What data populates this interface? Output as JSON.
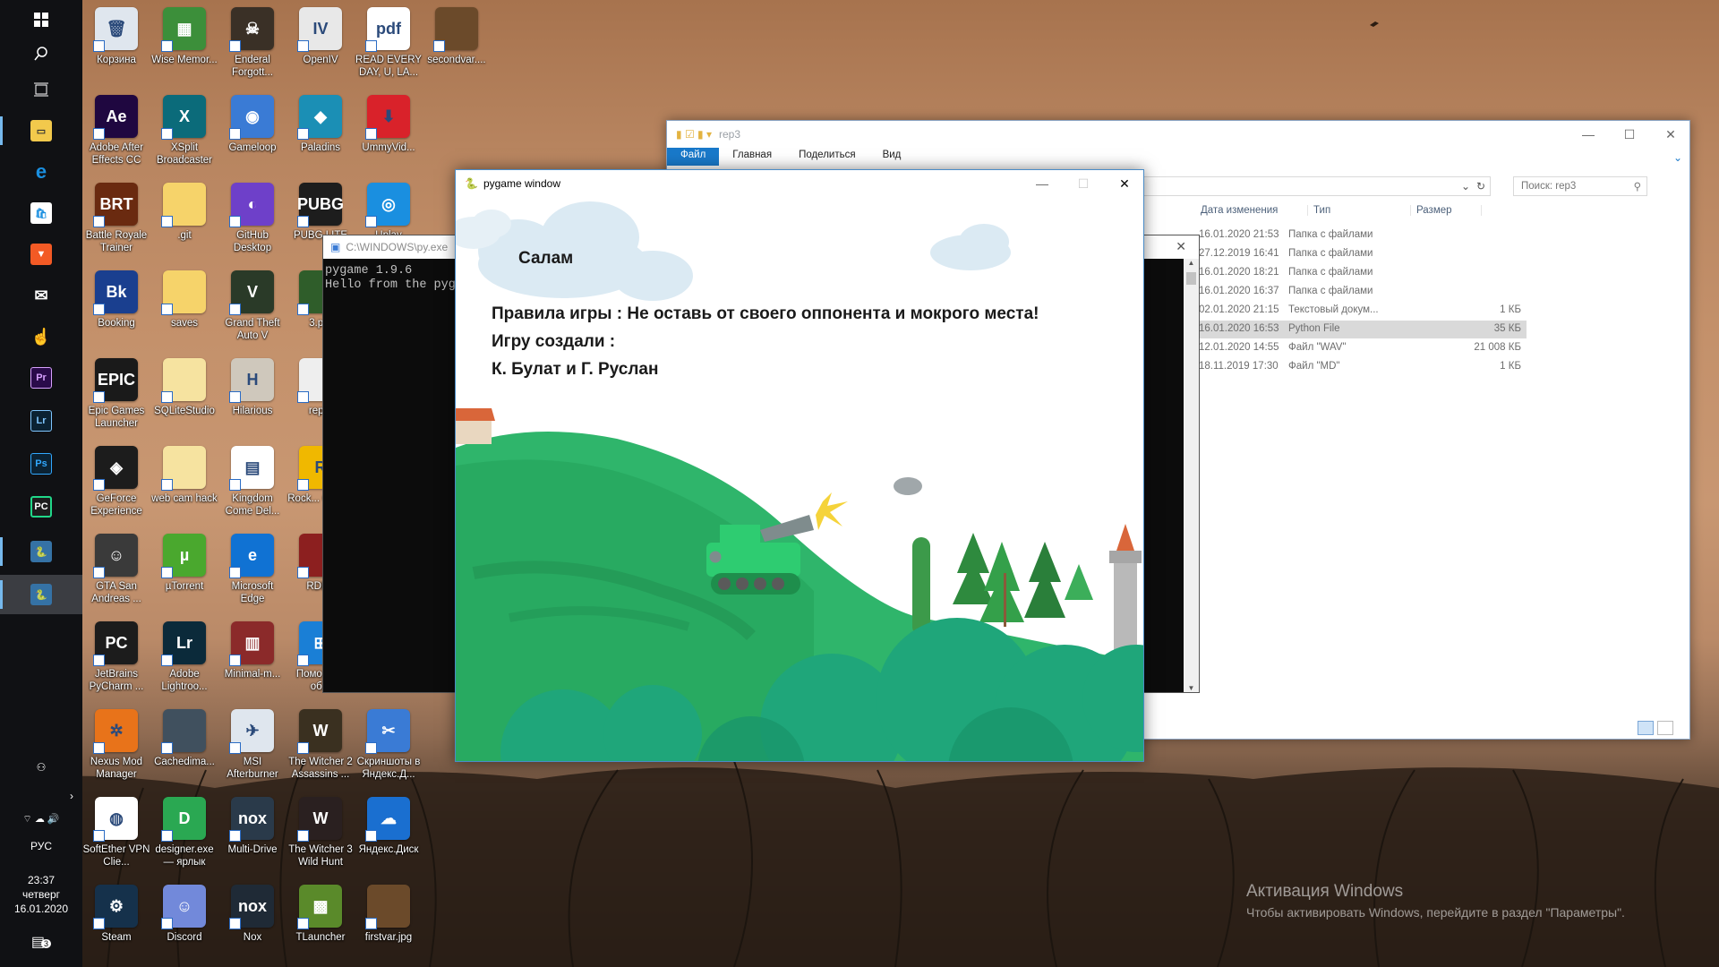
{
  "taskbar": {
    "language": "РУС",
    "time": "23:37",
    "weekday": "четверг",
    "date": "16.01.2020",
    "notifications_count": "3",
    "apps": [
      {
        "name": "file-explorer"
      },
      {
        "name": "edge",
        "label": "e"
      },
      {
        "name": "store"
      },
      {
        "name": "brave"
      },
      {
        "name": "mail"
      },
      {
        "name": "touch"
      },
      {
        "name": "premiere",
        "label": "Pr"
      },
      {
        "name": "lightroom",
        "label": "Lr"
      },
      {
        "name": "photoshop",
        "label": "Ps"
      },
      {
        "name": "pycharm",
        "label": "PC"
      },
      {
        "name": "python-idle"
      },
      {
        "name": "pygame"
      }
    ]
  },
  "desktop_icons": [
    {
      "label": "Корзина",
      "color": "#dfe6ee",
      "glyph": "🗑"
    },
    {
      "label": "Wise Memor...",
      "color": "#3c8f3a",
      "glyph": "▦"
    },
    {
      "label": "Enderal Forgott...",
      "color": "#3a3026",
      "glyph": "☠"
    },
    {
      "label": "OpenIV",
      "color": "#e8e8e8",
      "glyph": "IV"
    },
    {
      "label": "READ EVERY DAY, U, LA...",
      "color": "#ffffff",
      "glyph": "pdf"
    },
    {
      "label": "secondvar....",
      "color": "#6b4a2a",
      "glyph": ""
    },
    {
      "label": "Adobe After Effects CC",
      "color": "#1f0740",
      "glyph": "Ae"
    },
    {
      "label": "XSplit Broadcaster",
      "color": "#0b6b7a",
      "glyph": "X"
    },
    {
      "label": "Gameloop",
      "color": "#3a7bd5",
      "glyph": "◉"
    },
    {
      "label": "Paladins",
      "color": "#1b8fb5",
      "glyph": "◆"
    },
    {
      "label": "UmmyVid...",
      "color": "#d9222a",
      "glyph": "⬇"
    },
    {
      "label": "Battle Royale Trainer",
      "color": "#6a2a10",
      "glyph": "BRT"
    },
    {
      "label": ".git",
      "color": "#f6d36a",
      "glyph": ""
    },
    {
      "label": "GitHub Desktop",
      "color": "#6e40c9",
      "glyph": "◐"
    },
    {
      "label": "PUBG LITE",
      "color": "#1d1d1d",
      "glyph": "PUBG"
    },
    {
      "label": "Uplay",
      "color": "#1a8fe0",
      "glyph": "◎"
    },
    {
      "label": "Booking",
      "color": "#1a3f8f",
      "glyph": "Bk"
    },
    {
      "label": "saves",
      "color": "#f6d36a",
      "glyph": ""
    },
    {
      "label": "Grand Theft Auto V",
      "color": "#2a3a28",
      "glyph": "V"
    },
    {
      "label": "3.p...",
      "color": "#2f5d2a",
      "glyph": ""
    },
    {
      "label": "Epic Games Launcher",
      "color": "#1a1a1a",
      "glyph": "EPIC"
    },
    {
      "label": "SQLiteStudio",
      "color": "#f6e3a0",
      "glyph": ""
    },
    {
      "label": "Hilarious",
      "color": "#cfc8bc",
      "glyph": "H"
    },
    {
      "label": "rep...",
      "color": "#eeeeee",
      "glyph": ""
    },
    {
      "label": "GeForce Experience",
      "color": "#1c1c1c",
      "glyph": "◈"
    },
    {
      "label": "web cam hack",
      "color": "#f6e3a0",
      "glyph": ""
    },
    {
      "label": "Kingdom Come Del...",
      "color": "#ffffff",
      "glyph": "▤"
    },
    {
      "label": "Rock... Gam...",
      "color": "#f0b800",
      "glyph": "R"
    },
    {
      "label": "GTA San Andreas ...",
      "color": "#3a3a3a",
      "glyph": "☺"
    },
    {
      "label": "µTorrent",
      "color": "#4aa82e",
      "glyph": "µ"
    },
    {
      "label": "Microsoft Edge",
      "color": "#1072d3",
      "glyph": "e"
    },
    {
      "label": "RDR2",
      "color": "#8c1f1f",
      "glyph": ""
    },
    {
      "label": "JetBrains PyCharm ...",
      "color": "#1c1c1c",
      "glyph": "PC"
    },
    {
      "label": "Adobe Lightroo...",
      "color": "#0b2a3a",
      "glyph": "Lr"
    },
    {
      "label": "Minimal-m...",
      "color": "#8b2a2a",
      "glyph": "▥"
    },
    {
      "label": "Помо... по об...",
      "color": "#1a7fd6",
      "glyph": "⊞"
    },
    {
      "label": "Nexus Mod Manager",
      "color": "#e8731a",
      "glyph": "✲"
    },
    {
      "label": "Cachedima...",
      "color": "#40505e",
      "glyph": ""
    },
    {
      "label": "MSI Afterburner",
      "color": "#dfe6ee",
      "glyph": "✈"
    },
    {
      "label": "The Witcher 2 Assassins ...",
      "color": "#3a3020",
      "glyph": "W"
    },
    {
      "label": "Скриншоты в Яндекс.Д...",
      "color": "#3a7bd5",
      "glyph": "✂"
    },
    {
      "label": "SoftEther VPN Clie...",
      "color": "#ffffff",
      "glyph": "◍"
    },
    {
      "label": "designer.exe — ярлык",
      "color": "#2aa852",
      "glyph": "D"
    },
    {
      "label": "Multi-Drive",
      "color": "#2a3a4a",
      "glyph": "nox"
    },
    {
      "label": "The Witcher 3 Wild Hunt",
      "color": "#2a2020",
      "glyph": "W"
    },
    {
      "label": "Яндекс.Диск",
      "color": "#1a6fd0",
      "glyph": "☁"
    },
    {
      "label": "Steam",
      "color": "#15314b",
      "glyph": "⚙"
    },
    {
      "label": "Discord",
      "color": "#7289da",
      "glyph": "☺"
    },
    {
      "label": "Nox",
      "color": "#1f2a36",
      "glyph": "nox"
    },
    {
      "label": "TLauncher",
      "color": "#5a8a2a",
      "glyph": "▩"
    },
    {
      "label": "firstvar.jpg",
      "color": "#6b4a2a",
      "glyph": ""
    }
  ],
  "explorer": {
    "title": "rep3",
    "ribbon_tabs": [
      "Файл",
      "Главная",
      "Поделиться",
      "Вид"
    ],
    "search_placeholder": "Поиск: rep3",
    "columns": [
      "Дата изменения",
      "Тип",
      "Размер"
    ],
    "rows": [
      {
        "date": "16.01.2020 21:53",
        "type": "Папка с файлами",
        "size": ""
      },
      {
        "date": "27.12.2019 16:41",
        "type": "Папка с файлами",
        "size": ""
      },
      {
        "date": "16.01.2020 18:21",
        "type": "Папка с файлами",
        "size": ""
      },
      {
        "date": "16.01.2020 16:37",
        "type": "Папка с файлами",
        "size": ""
      },
      {
        "date": "02.01.2020 21:15",
        "type": "Текстовый докум...",
        "size": "1 КБ"
      },
      {
        "date": "16.01.2020 16:53",
        "type": "Python File",
        "size": "35 КБ",
        "selected": true
      },
      {
        "date": "12.01.2020 14:55",
        "type": "Файл \"WAV\"",
        "size": "21 008 КБ"
      },
      {
        "date": "18.11.2019 17:30",
        "type": "Файл \"MD\"",
        "size": "1 КБ"
      }
    ]
  },
  "console": {
    "title": "C:\\WINDOWS\\py.exe",
    "line1": "pygame 1.9.6",
    "line2": "Hello from the pyga"
  },
  "pygame": {
    "title": "pygame window",
    "greeting": "Салам",
    "rules": "Правила игры : Не оставь от своего оппонента и мокрого места!",
    "credits_label": "Игру создали :",
    "authors": "К. Булат и Г. Руслан"
  },
  "watermark": {
    "title": "Активация Windows",
    "subtitle": "Чтобы активировать Windows, перейдите в раздел \"Параметры\"."
  }
}
